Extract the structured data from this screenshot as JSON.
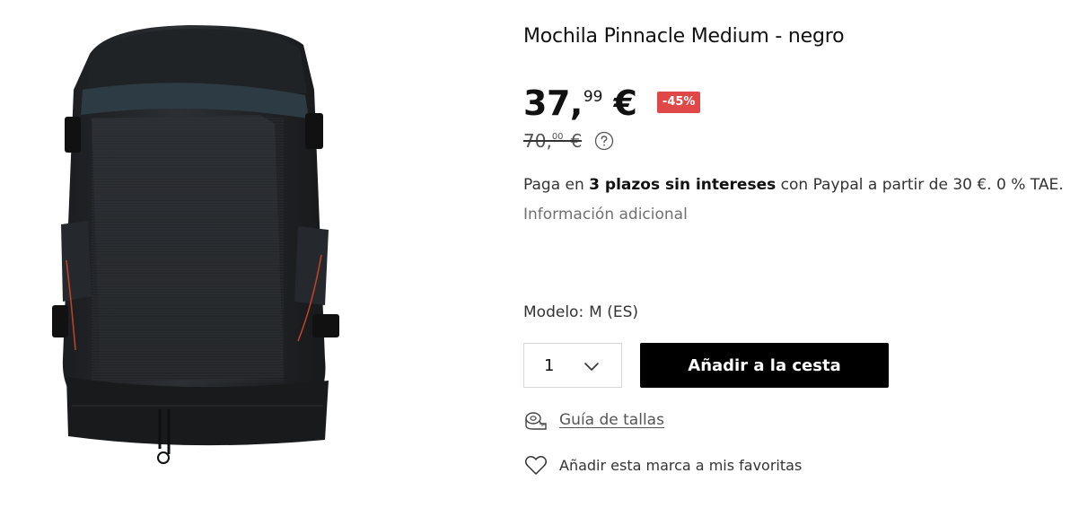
{
  "product": {
    "title": "Mochila Pinnacle Medium - negro",
    "price": {
      "integer": "37,",
      "decimals": "99",
      "currency": "€"
    },
    "discount_badge": "-45%",
    "old_price": {
      "integer": "70,",
      "decimals": "00",
      "currency": "€"
    },
    "paypal": {
      "prefix": "Paga en",
      "bold": "3 plazos sin intereses",
      "suffix": "con Paypal a partir de 30 €. 0 % TAE."
    },
    "info_link": "Información adicional",
    "model": {
      "label": "Modelo:",
      "value": "M (ES)"
    },
    "quantity": {
      "value": "1"
    },
    "add_to_cart_label": "Añadir a la cesta",
    "size_guide_label": "Guía de tallas",
    "favorite_label": "Añadir esta marca a mis favoritas"
  },
  "colors": {
    "badge": "#e04848",
    "button_bg": "#000000",
    "button_text": "#ffffff"
  },
  "icons": {
    "help": "question-circle-icon",
    "chevron": "chevron-down-icon",
    "size_guide": "measuring-tape-icon",
    "favorite": "heart-outline-icon"
  }
}
